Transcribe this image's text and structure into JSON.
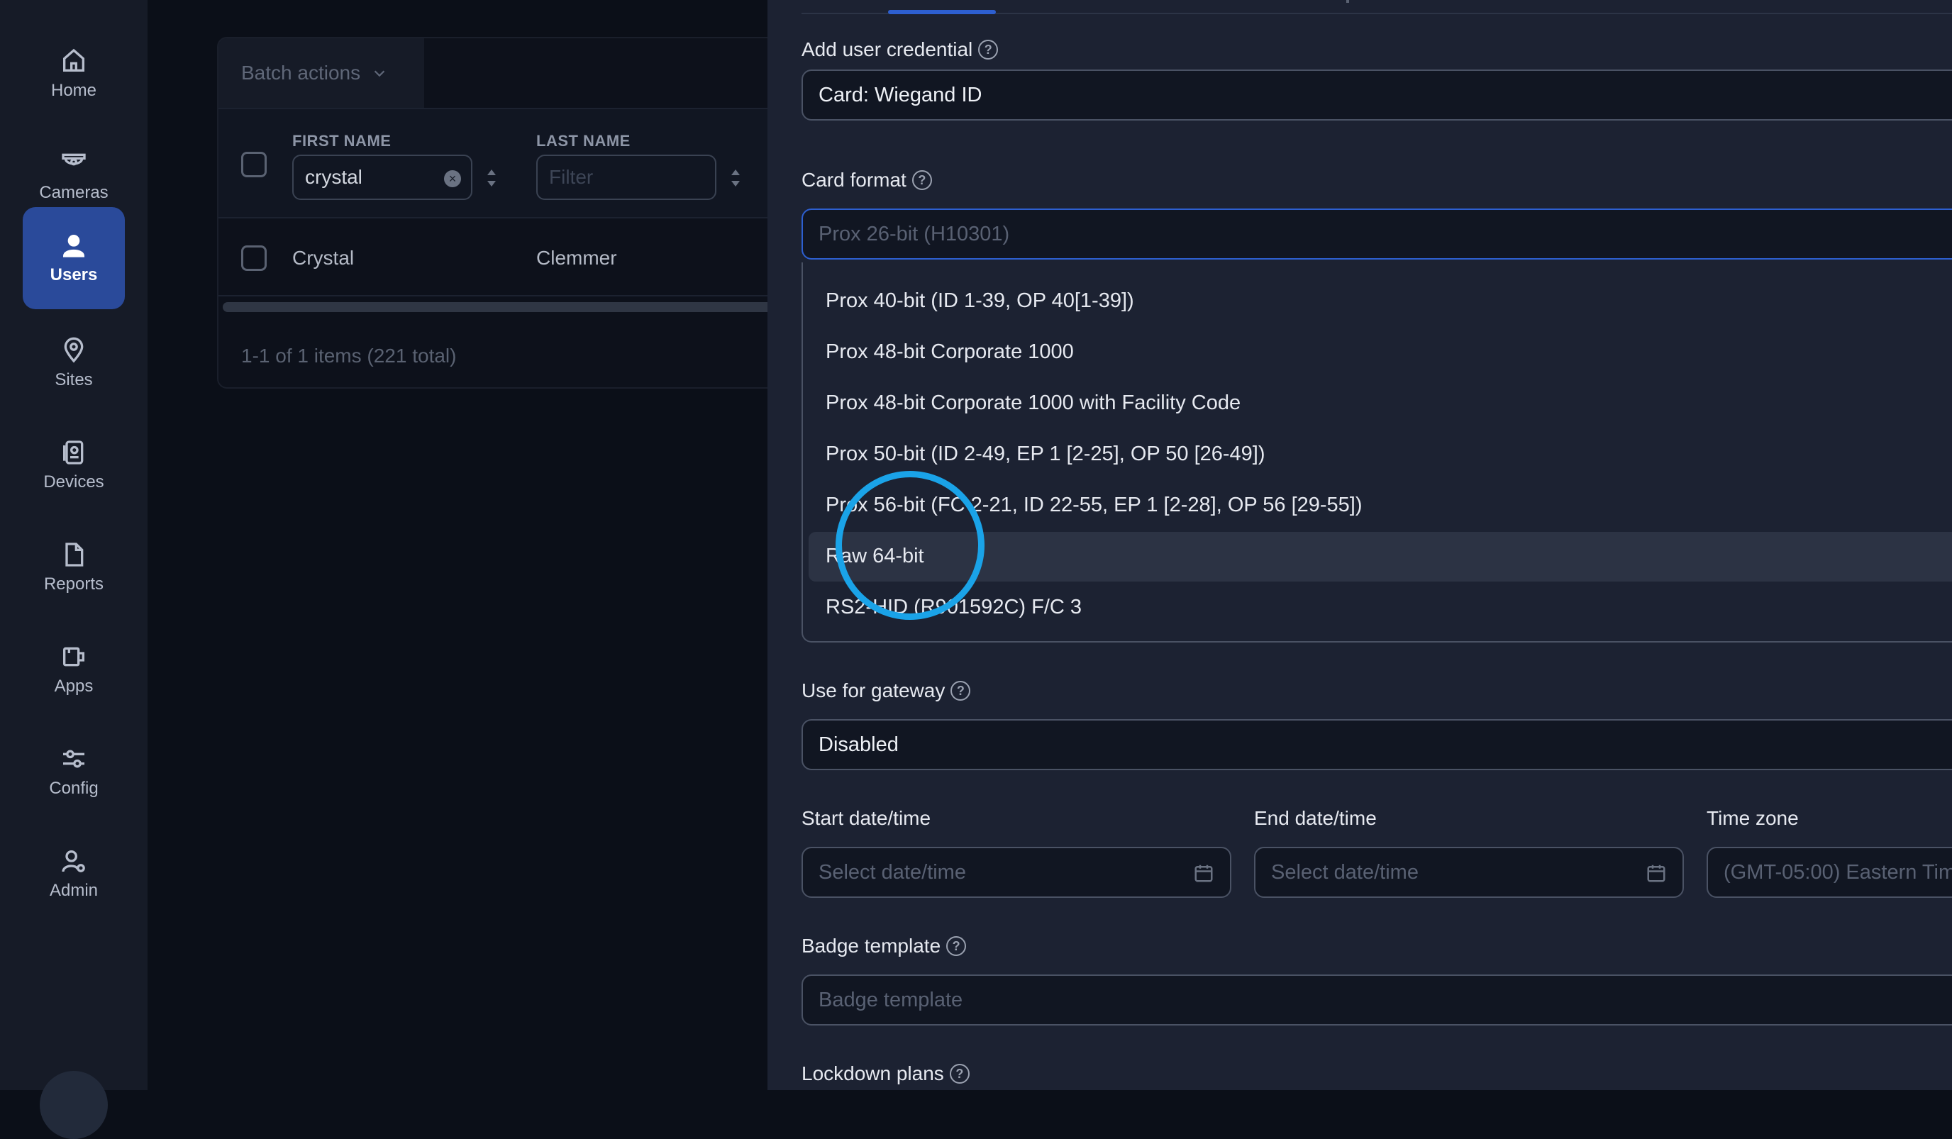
{
  "sidebar": {
    "items": [
      {
        "label": "Home",
        "icon": "home-icon"
      },
      {
        "label": "Cameras",
        "icon": "camera-icon"
      },
      {
        "label": "Users",
        "icon": "user-icon",
        "active": true
      },
      {
        "label": "Sites",
        "icon": "map-pin-icon"
      },
      {
        "label": "Devices",
        "icon": "device-icon"
      },
      {
        "label": "Reports",
        "icon": "file-icon"
      },
      {
        "label": "Apps",
        "icon": "apps-icon"
      },
      {
        "label": "Config",
        "icon": "sliders-icon"
      },
      {
        "label": "Admin",
        "icon": "admin-user-gear-icon"
      }
    ]
  },
  "users_list": {
    "batch_actions": "Batch actions",
    "columns": {
      "first_name": {
        "title": "FIRST NAME",
        "filter_value": "crystal"
      },
      "last_name": {
        "title": "LAST NAME",
        "filter_placeholder": "Filter"
      }
    },
    "rows": [
      {
        "first_name": "Crystal",
        "last_name": "Clemmer"
      }
    ],
    "pager": "1-1 of 1 items (221 total)"
  },
  "form": {
    "credential": {
      "label": "Add user credential",
      "value": "Card: Wiegand ID"
    },
    "card_format": {
      "label": "Card format",
      "placeholder": "Prox 26-bit (H10301)",
      "options": [
        "Prox 40-bit (ID 1-39, OP 40[1-39])",
        "Prox 48-bit Corporate 1000",
        "Prox 48-bit Corporate 1000 with Facility Code",
        "Prox 50-bit (ID 2-49, EP 1 [2-25], OP 50 [26-49])",
        "Prox 56-bit (FC 2-21, ID 22-55, EP 1 [2-28], OP 56 [29-55])",
        "Raw 64-bit",
        "RS2-HID (R901592C) F/C 3"
      ],
      "highlighted": "Raw 64-bit"
    },
    "gateway": {
      "label": "Use for gateway",
      "value": "Disabled"
    },
    "start": {
      "label": "Start date/time",
      "placeholder": "Select date/time"
    },
    "end": {
      "label": "End date/time",
      "placeholder": "Select date/time"
    },
    "timezone": {
      "label": "Time zone",
      "value": "(GMT-05:00) Eastern Tim"
    },
    "badge": {
      "label": "Badge template",
      "placeholder": "Badge template"
    },
    "lockdown": {
      "label": "Lockdown plans"
    }
  },
  "colors": {
    "accent": "#2d5fd0",
    "cursor_ring": "#1aa3e8",
    "drawer_bg": "#1c2232",
    "sidebar_bg": "#161b27"
  }
}
